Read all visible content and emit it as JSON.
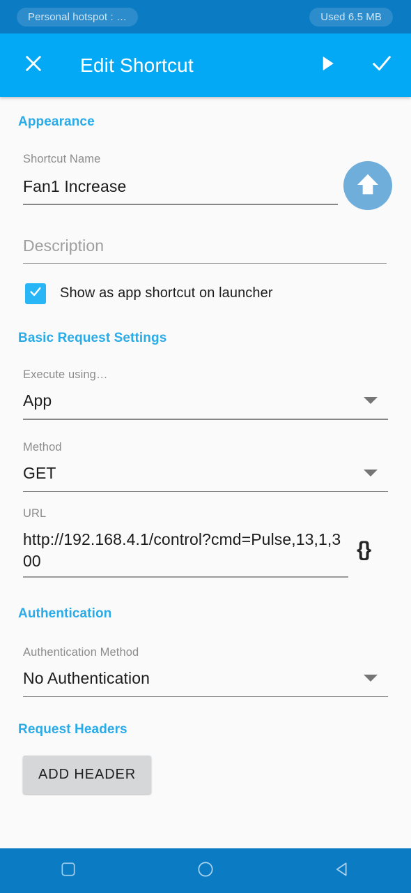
{
  "status_bar": {
    "hotspot": "Personal hotspot : …",
    "data_usage": "Used  6.5 MB",
    "background": "#0B7BC4"
  },
  "app_bar": {
    "title": "Edit Shortcut",
    "background": "#03A9F4",
    "close_icon": "close-icon",
    "run_icon": "play-icon",
    "save_icon": "check-icon"
  },
  "sections": {
    "appearance": {
      "heading": "Appearance",
      "shortcut_name": {
        "label": "Shortcut Name",
        "value": "Fan1 Increase"
      },
      "description": {
        "placeholder": "Description",
        "value": ""
      },
      "show_on_launcher": {
        "label": "Show as app shortcut on launcher",
        "checked": true
      },
      "icon": {
        "name": "arrow-up-icon",
        "background": "#6FAEDB",
        "glyph": "▲"
      }
    },
    "basic_request": {
      "heading": "Basic Request Settings",
      "execute_using": {
        "label": "Execute using…",
        "value": "App"
      },
      "method": {
        "label": "Method",
        "value": "GET"
      },
      "url": {
        "label": "URL",
        "value": "http://192.168.4.1/control?cmd=Pulse,13,1,300",
        "variable_button": "{}"
      }
    },
    "authentication": {
      "heading": "Authentication",
      "auth_method": {
        "label": "Authentication Method",
        "value": "No Authentication"
      }
    },
    "request_headers": {
      "heading": "Request Headers",
      "add_header_label": "ADD HEADER"
    }
  },
  "nav_bar": {
    "background": "#0B7BC4",
    "recents_icon": "square-recents-icon",
    "home_icon": "circle-home-icon",
    "back_icon": "triangle-back-icon"
  },
  "colors": {
    "accent": "#29ABE8",
    "app_bar": "#03A9F4",
    "status_bar": "#0B7BC4",
    "page_background": "#fafafa",
    "checkbox": "#29B6F6"
  }
}
